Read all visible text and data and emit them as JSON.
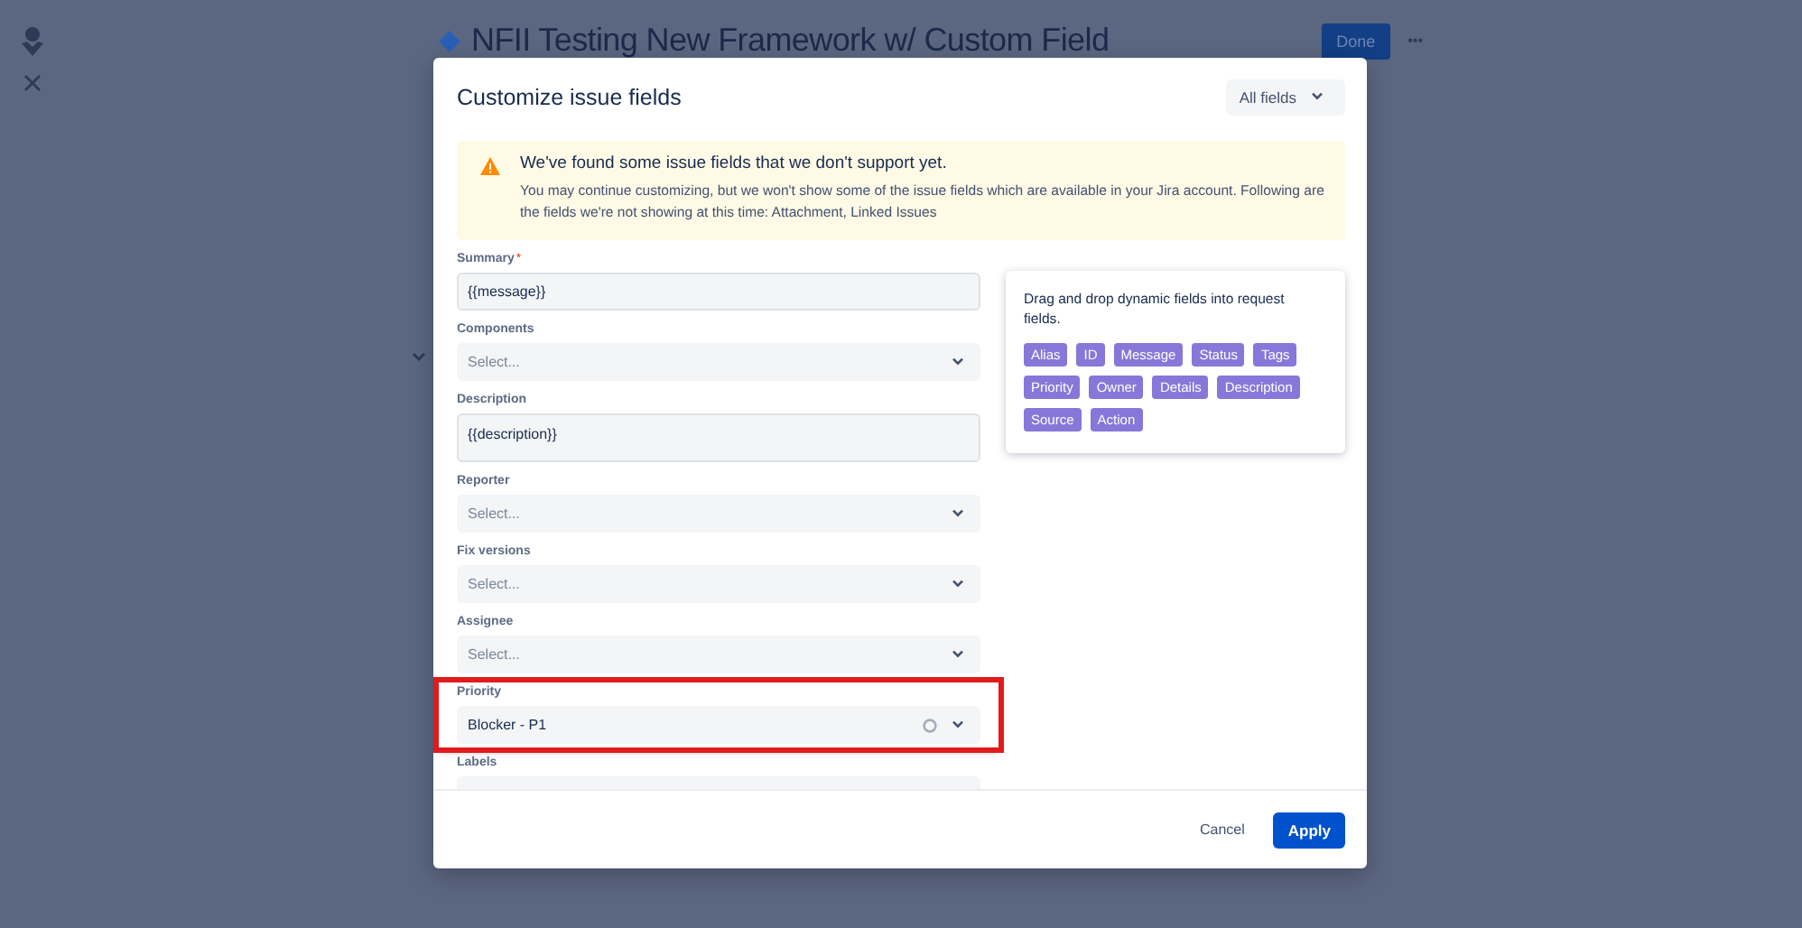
{
  "page": {
    "title": "NFII Testing New Framework w/ Custom Field",
    "done_button": "Done",
    "more_button": "•••"
  },
  "dialog": {
    "title": "Customize issue fields",
    "filter_button": "All fields",
    "warning": {
      "title": "We've found some issue fields that we don't support yet.",
      "text": "You may continue customizing, but we won't show some of the issue fields which are available in your Jira account. Following are the fields we're not showing at this time: Attachment, Linked Issues"
    },
    "fields": [
      {
        "label": "Summary",
        "required_mark": "*",
        "kind": "text",
        "value": "{{message}}",
        "highlighted": false
      },
      {
        "label": "Components",
        "kind": "select",
        "placeholder": "Select...",
        "highlighted": false
      },
      {
        "label": "Description",
        "kind": "textarea",
        "value": "{{description}}",
        "highlighted": false
      },
      {
        "label": "Reporter",
        "kind": "select",
        "placeholder": "Select...",
        "highlighted": false
      },
      {
        "label": "Fix versions",
        "kind": "select",
        "placeholder": "Select...",
        "highlighted": false
      },
      {
        "label": "Assignee",
        "kind": "select",
        "placeholder": "Select...",
        "highlighted": false
      },
      {
        "label": "Priority",
        "kind": "select",
        "value": "Blocker - P1",
        "clearable": true,
        "highlighted": true
      },
      {
        "label": "Labels",
        "kind": "select",
        "highlighted": false
      }
    ],
    "dynamic_fields": {
      "hint": "Drag and drop dynamic fields into request fields.",
      "tags": [
        "Alias",
        "ID",
        "Message",
        "Status",
        "Tags",
        "Priority",
        "Owner",
        "Details",
        "Description",
        "Source",
        "Action"
      ]
    },
    "cancel_button": "Cancel",
    "apply_button": "Apply"
  }
}
